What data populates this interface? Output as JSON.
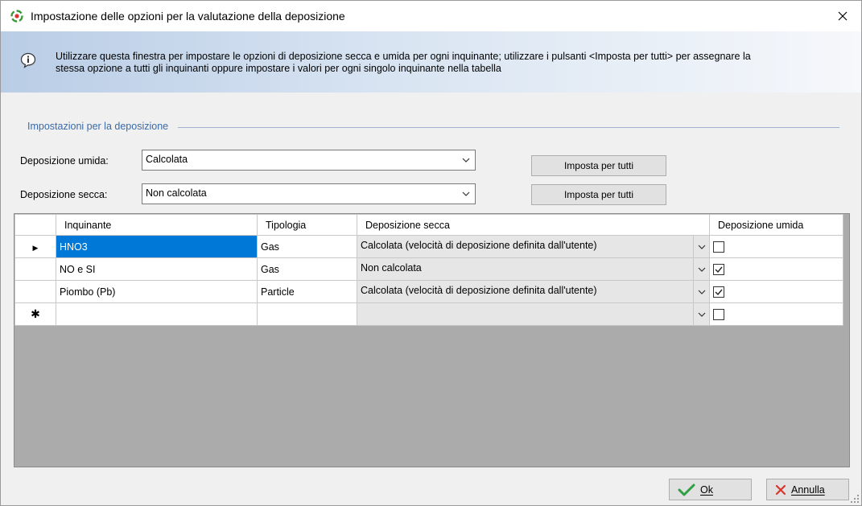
{
  "window": {
    "title": "Impostazione delle opzioni per la valutazione della deposizione"
  },
  "info": {
    "line1": "Utilizzare questa finestra per impostare le opzioni di deposizione secca e umida per ogni inquinante; utilizzare i pulsanti <Imposta per tutti> per assegnare la",
    "line2": "stessa opzione a tutti gli inquinanti oppure impostare i valori per ogni singolo inquinante nella tabella"
  },
  "group": {
    "label": "Impostazioni per la deposizione"
  },
  "wet": {
    "label": "Deposizione umida:",
    "value": "Calcolata",
    "button": "Imposta per tutti"
  },
  "dry": {
    "label": "Deposizione secca:",
    "value": "Non calcolata",
    "button": "Imposta per tutti"
  },
  "grid": {
    "columns": [
      "Inquinante",
      "Tipologia",
      "Deposizione secca",
      "Deposizione umida"
    ],
    "rows": [
      {
        "marker": "▶",
        "inquinante": "HNO3",
        "tipologia": "Gas",
        "secca": "Calcolata (velocità di deposizione definita dall'utente)",
        "umida": false
      },
      {
        "marker": "",
        "inquinante": "NO e SI",
        "tipologia": "Gas",
        "secca": "Non calcolata",
        "umida": true
      },
      {
        "marker": "",
        "inquinante": "Piombo (Pb)",
        "tipologia": "Particle",
        "secca": "Calcolata (velocità di deposizione definita dall'utente)",
        "umida": true
      },
      {
        "marker": "✱",
        "inquinante": "",
        "tipologia": "",
        "secca": "",
        "umida": false
      }
    ]
  },
  "footer": {
    "ok": "Ok",
    "cancel": "Annulla"
  },
  "colors": {
    "selection": "#0078d7",
    "group_label": "#3a6aa8",
    "ok_check": "#2ea043",
    "cancel_x": "#d9362b"
  }
}
